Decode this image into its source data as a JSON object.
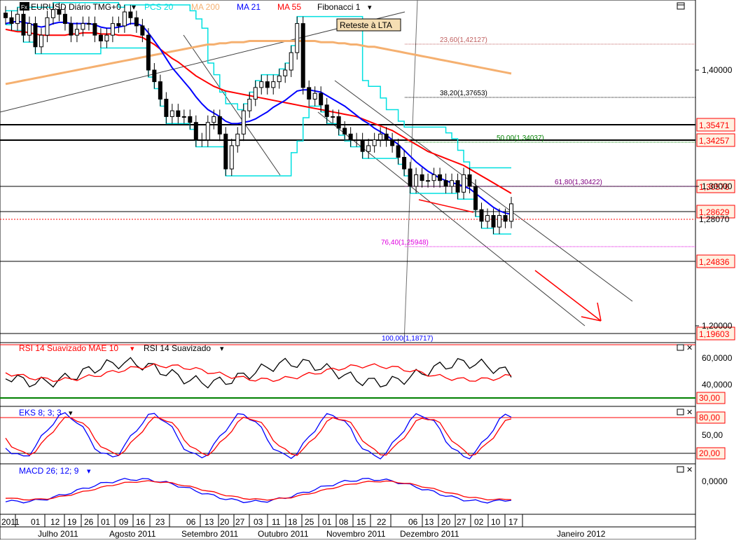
{
  "main": {
    "symbol": "EURUSD Diário TMG+0",
    "indicators": [
      {
        "label": "PCS 20",
        "color": "#00e0e0"
      },
      {
        "label": "MA 200",
        "color": "#f5b070"
      },
      {
        "label": "MA 21",
        "color": "#0000ff"
      },
      {
        "label": "MA 55",
        "color": "#ff0000"
      },
      {
        "label": "Fibonacci 1",
        "color": "#000000"
      }
    ],
    "annotation": "Reteste à LTA",
    "fib_labels": [
      {
        "text": "23,60(1,42127)",
        "color": "#c06060"
      },
      {
        "text": "38,20(1,37653)",
        "color": "#000000"
      },
      {
        "text": "50,00(1,34037)",
        "color": "#008000"
      },
      {
        "text": "61,80(1,30422)",
        "color": "#800080"
      },
      {
        "text": "76,40(1,25948)",
        "color": "#e000e0"
      },
      {
        "text": "100,00(1,18717)",
        "color": "#0000ff"
      }
    ],
    "y_ticks": [
      "1,40000",
      "1,30000",
      "1,20000"
    ],
    "price_tags": [
      "1,35471",
      "1,34257",
      "1,30576",
      "1,28629",
      "1,24836",
      "1,19603"
    ],
    "current_price_label": "1,28070"
  },
  "rsi": {
    "label_main": "RSI 14 Suavizado MAE 10",
    "label_second": "RSI 14 Suavizado",
    "y_ticks": [
      "60,0000",
      "40,0000"
    ],
    "level_tag": "30,00"
  },
  "stoch": {
    "label": "EKS 8; 3; 3",
    "y_ticks": [
      "50,00"
    ],
    "level_tags": [
      "80,00",
      "20,00"
    ]
  },
  "macd": {
    "label": "MACD 26; 12; 9",
    "y_ticks": [
      "0,0000"
    ]
  },
  "x_axis": {
    "day_ticks": [
      "2011",
      "01",
      "12",
      "19",
      "26",
      "01",
      "09",
      "16",
      "23",
      "06",
      "13",
      "20",
      "27",
      "03",
      "11",
      "18",
      "25",
      "01",
      "08",
      "15",
      "22",
      "06",
      "13",
      "20",
      "27",
      "02",
      "10",
      "17"
    ],
    "months": [
      "Julho 2011",
      "Agosto 2011",
      "Setembro 2011",
      "Outubro 2011",
      "Novembro 2011",
      "Dezembro 2011",
      "Janeiro 2012"
    ]
  },
  "chart_data": {
    "type": "candlestick",
    "title": "EURUSD Diário TMG+0",
    "ylim": [
      1.18,
      1.47
    ],
    "series_names": [
      "PCS 20",
      "MA 200",
      "MA 21",
      "MA 55",
      "Fibonacci 1"
    ],
    "close": [
      1.445,
      1.44,
      1.448,
      1.43,
      1.44,
      1.42,
      1.43,
      1.445,
      1.452,
      1.448,
      1.44,
      1.43,
      1.435,
      1.44,
      1.44,
      1.43,
      1.425,
      1.43,
      1.44,
      1.438,
      1.45,
      1.445,
      1.438,
      1.43,
      1.4,
      1.39,
      1.375,
      1.36,
      1.365,
      1.36,
      1.36,
      1.355,
      1.34,
      1.34,
      1.355,
      1.36,
      1.345,
      1.315,
      1.335,
      1.345,
      1.365,
      1.375,
      1.385,
      1.39,
      1.385,
      1.39,
      1.395,
      1.4,
      1.415,
      1.44,
      1.385,
      1.375,
      1.38,
      1.37,
      1.36,
      1.36,
      1.35,
      1.345,
      1.34,
      1.34,
      1.33,
      1.335,
      1.34,
      1.345,
      1.34,
      1.335,
      1.325,
      1.315,
      1.3,
      1.31,
      1.305,
      1.305,
      1.31,
      1.305,
      1.3,
      1.305,
      1.295,
      1.31,
      1.3,
      1.28,
      1.27,
      1.275,
      1.265,
      1.275,
      1.27,
      1.285
    ],
    "ma21": [
      1.44,
      1.441,
      1.442,
      1.441,
      1.44,
      1.438,
      1.437,
      1.438,
      1.44,
      1.441,
      1.441,
      1.44,
      1.44,
      1.44,
      1.44,
      1.439,
      1.437,
      1.436,
      1.436,
      1.437,
      1.438,
      1.44,
      1.44,
      1.438,
      1.432,
      1.425,
      1.418,
      1.41,
      1.402,
      1.396,
      1.39,
      1.384,
      1.377,
      1.371,
      1.366,
      1.363,
      1.36,
      1.356,
      1.354,
      1.354,
      1.355,
      1.356,
      1.358,
      1.361,
      1.364,
      1.368,
      1.371,
      1.374,
      1.378,
      1.382,
      1.383,
      1.383,
      1.382,
      1.381,
      1.378,
      1.375,
      1.372,
      1.369,
      1.365,
      1.361,
      1.357,
      1.354,
      1.35,
      1.347,
      1.344,
      1.34,
      1.336,
      1.331,
      1.326,
      1.321,
      1.317,
      1.313,
      1.31,
      1.307,
      1.305,
      1.303,
      1.302,
      1.3,
      1.298,
      1.294,
      1.29,
      1.286,
      1.282,
      1.279,
      1.277,
      1.276
    ],
    "ma55": [
      1.435,
      1.434,
      1.433,
      1.433,
      1.432,
      1.431,
      1.43,
      1.43,
      1.43,
      1.43,
      1.43,
      1.431,
      1.431,
      1.432,
      1.432,
      1.432,
      1.431,
      1.431,
      1.431,
      1.43,
      1.43,
      1.43,
      1.429,
      1.428,
      1.425,
      1.422,
      1.418,
      1.414,
      1.41,
      1.407,
      1.403,
      1.399,
      1.395,
      1.392,
      1.389,
      1.386,
      1.384,
      1.382,
      1.381,
      1.38,
      1.379,
      1.378,
      1.377,
      1.376,
      1.375,
      1.374,
      1.373,
      1.372,
      1.371,
      1.37,
      1.369,
      1.368,
      1.367,
      1.366,
      1.365,
      1.364,
      1.363,
      1.362,
      1.361,
      1.36,
      1.358,
      1.356,
      1.354,
      1.352,
      1.35,
      1.348,
      1.345,
      1.342,
      1.339,
      1.336,
      1.333,
      1.33,
      1.328,
      1.326,
      1.324,
      1.322,
      1.32,
      1.318,
      1.315,
      1.312,
      1.309,
      1.306,
      1.303,
      1.3,
      1.297,
      1.294
    ],
    "ma200": [
      1.388,
      1.389,
      1.39,
      1.391,
      1.392,
      1.393,
      1.394,
      1.395,
      1.396,
      1.397,
      1.398,
      1.399,
      1.4,
      1.401,
      1.402,
      1.403,
      1.404,
      1.405,
      1.406,
      1.407,
      1.408,
      1.409,
      1.41,
      1.411,
      1.412,
      1.413,
      1.414,
      1.415,
      1.416,
      1.417,
      1.418,
      1.419,
      1.42,
      1.421,
      1.422,
      1.422,
      1.423,
      1.423,
      1.424,
      1.424,
      1.424,
      1.425,
      1.425,
      1.425,
      1.425,
      1.425,
      1.425,
      1.425,
      1.425,
      1.425,
      1.425,
      1.425,
      1.425,
      1.424,
      1.424,
      1.424,
      1.423,
      1.423,
      1.422,
      1.422,
      1.421,
      1.42,
      1.42,
      1.419,
      1.418,
      1.417,
      1.416,
      1.415,
      1.414,
      1.413,
      1.412,
      1.411,
      1.41,
      1.409,
      1.408,
      1.407,
      1.406,
      1.405,
      1.404,
      1.403,
      1.402,
      1.401,
      1.4,
      1.399,
      1.398,
      1.397
    ],
    "horizontal_levels": [
      1.35471,
      1.34257,
      1.30576,
      1.28629,
      1.24836,
      1.19603
    ],
    "fibonacci": [
      {
        "level": "23,60",
        "price": 1.42127
      },
      {
        "level": "38,20",
        "price": 1.37653
      },
      {
        "level": "50,00",
        "price": 1.34037
      },
      {
        "level": "61,80",
        "price": 1.30422
      },
      {
        "level": "76,40",
        "price": 1.25948
      },
      {
        "level": "100,00",
        "price": 1.18717
      }
    ],
    "rsi_level": 30,
    "stoch_levels": [
      80,
      20
    ]
  }
}
